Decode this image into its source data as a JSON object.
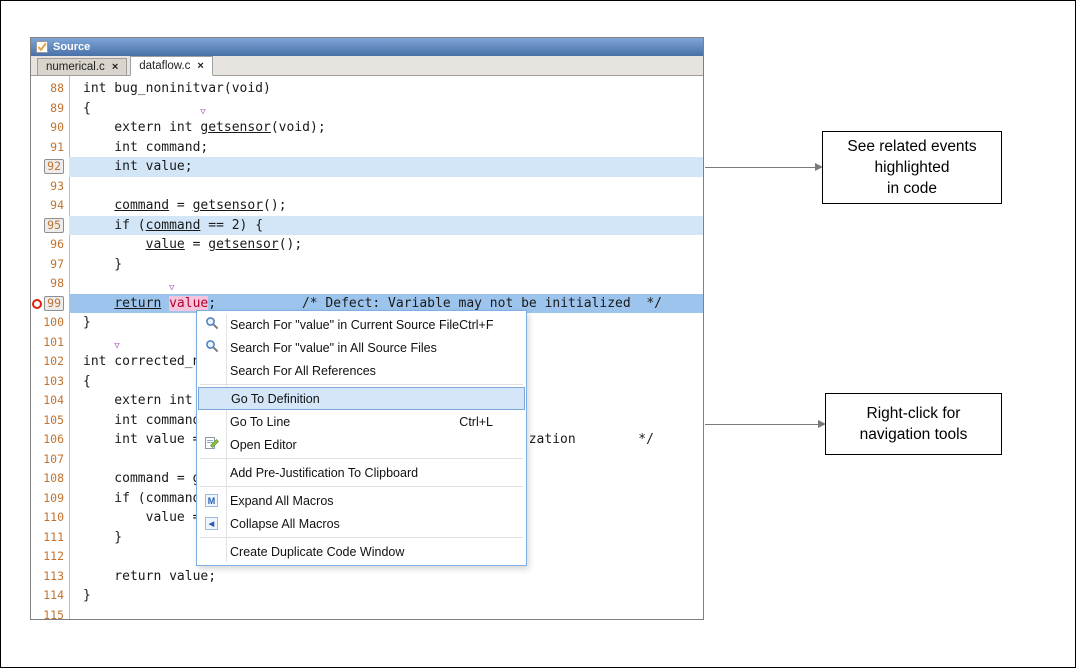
{
  "colors": {
    "titlebar-top": "#7fa5d6",
    "titlebar-bottom": "#4871a8",
    "hl-light": "#d3e6f8",
    "hl-strong": "#9cc4ed",
    "pink-bg": "#f6c3dc",
    "pink-text": "#b2002d",
    "lnum": "#c1722f",
    "menu-border": "#7fb0e3",
    "menu-selected-bg": "#d4e6f8",
    "menu-selected-border": "#7da7d9",
    "marker-purple": "#b14fc4",
    "defect-red": "#dd2211",
    "arrow-gray": "#7a7a7a"
  },
  "window": {
    "title": "Source",
    "icon": "source-panel-icon",
    "tabs": [
      {
        "label": "numerical.c",
        "close_label": "×",
        "active": false
      },
      {
        "label": "dataflow.c",
        "close_label": "×",
        "active": true
      }
    ]
  },
  "editor": {
    "lines": [
      {
        "n": "88",
        "tri": 4,
        "segs": [
          {
            "t": "int bug_noninitvar(void)"
          }
        ]
      },
      {
        "n": "89",
        "segs": [
          {
            "t": "{"
          }
        ]
      },
      {
        "n": "90",
        "tri": 15,
        "segs": [
          {
            "t": "    extern int "
          },
          {
            "t": "getsensor",
            "u": true
          },
          {
            "t": "(void);"
          }
        ]
      },
      {
        "n": "91",
        "segs": [
          {
            "t": "    int command;"
          }
        ]
      },
      {
        "n": "92",
        "boxed": true,
        "hl": "light",
        "segs": [
          {
            "t": "    int value;"
          }
        ]
      },
      {
        "n": "93",
        "segs": []
      },
      {
        "n": "94",
        "segs": [
          {
            "t": "    "
          },
          {
            "t": "command",
            "u": true
          },
          {
            "t": " = "
          },
          {
            "t": "getsensor",
            "u": true
          },
          {
            "t": "();"
          }
        ]
      },
      {
        "n": "95",
        "boxed": true,
        "hl": "light",
        "segs": [
          {
            "t": "    if ("
          },
          {
            "t": "command",
            "u": true
          },
          {
            "t": " == 2) {"
          }
        ]
      },
      {
        "n": "96",
        "segs": [
          {
            "t": "        "
          },
          {
            "t": "value",
            "u": true
          },
          {
            "t": " = "
          },
          {
            "t": "getsensor",
            "u": true
          },
          {
            "t": "();"
          }
        ]
      },
      {
        "n": "97",
        "segs": [
          {
            "t": "    }"
          }
        ]
      },
      {
        "n": "98",
        "segs": []
      },
      {
        "n": "99",
        "boxed": true,
        "hl": "strong",
        "defect": true,
        "tri": 11,
        "segs": [
          {
            "t": "    "
          },
          {
            "t": "return",
            "u": true
          },
          {
            "t": " "
          },
          {
            "t": "value",
            "pink": true
          },
          {
            "t": ";"
          },
          {
            "t": "/* Defect: Variable may not be initialized  */",
            "ch": 28
          }
        ]
      },
      {
        "n": "100",
        "segs": [
          {
            "t": "}"
          }
        ]
      },
      {
        "n": "101",
        "segs": []
      },
      {
        "n": "102",
        "tri": 4,
        "segs": [
          {
            "t": "int corrected_no"
          }
        ]
      },
      {
        "n": "103",
        "segs": [
          {
            "t": "{"
          }
        ]
      },
      {
        "n": "104",
        "tri": 15,
        "segs": [
          {
            "t": "    extern int g"
          }
        ]
      },
      {
        "n": "105",
        "segs": [
          {
            "t": "    int command;"
          }
        ]
      },
      {
        "n": "106",
        "segs": [
          {
            "t": "    int value = "
          },
          {
            "t": "zation        */",
            "ch": 57
          }
        ]
      },
      {
        "n": "107",
        "segs": []
      },
      {
        "n": "108",
        "segs": [
          {
            "t": "    command = ge"
          }
        ]
      },
      {
        "n": "109",
        "segs": [
          {
            "t": "    if (command"
          }
        ]
      },
      {
        "n": "110",
        "segs": [
          {
            "t": "        value = "
          }
        ]
      },
      {
        "n": "111",
        "segs": [
          {
            "t": "    }"
          }
        ]
      },
      {
        "n": "112",
        "segs": []
      },
      {
        "n": "113",
        "segs": [
          {
            "t": "    return value;"
          }
        ]
      },
      {
        "n": "114",
        "segs": [
          {
            "t": "}"
          }
        ]
      },
      {
        "n": "115",
        "segs": []
      }
    ]
  },
  "context_menu": {
    "items": [
      {
        "icon": "search-icon",
        "label": "Search For \"value\" in Current Source File",
        "shortcut": "Ctrl+F"
      },
      {
        "icon": "search-icon",
        "label": "Search For \"value\" in All Source Files"
      },
      {
        "label": "Search For All References",
        "sep_after": true
      },
      {
        "label": "Go To Definition",
        "selected": true
      },
      {
        "label": "Go To Line",
        "shortcut": "Ctrl+L"
      },
      {
        "icon": "open-editor-icon",
        "label": "Open Editor",
        "sep_after": true
      },
      {
        "label": "Add Pre-Justification To Clipboard",
        "sep_after": true
      },
      {
        "icon": "expand-macros-icon",
        "label": "Expand All Macros"
      },
      {
        "icon": "collapse-macros-icon",
        "label": "Collapse All Macros",
        "sep_after": true
      },
      {
        "label": "Create Duplicate Code Window"
      }
    ]
  },
  "annotations": [
    {
      "line1": "See related events highlighted",
      "line2": "in code"
    },
    {
      "line1": "Right-click for",
      "line2": "navigation tools"
    }
  ]
}
